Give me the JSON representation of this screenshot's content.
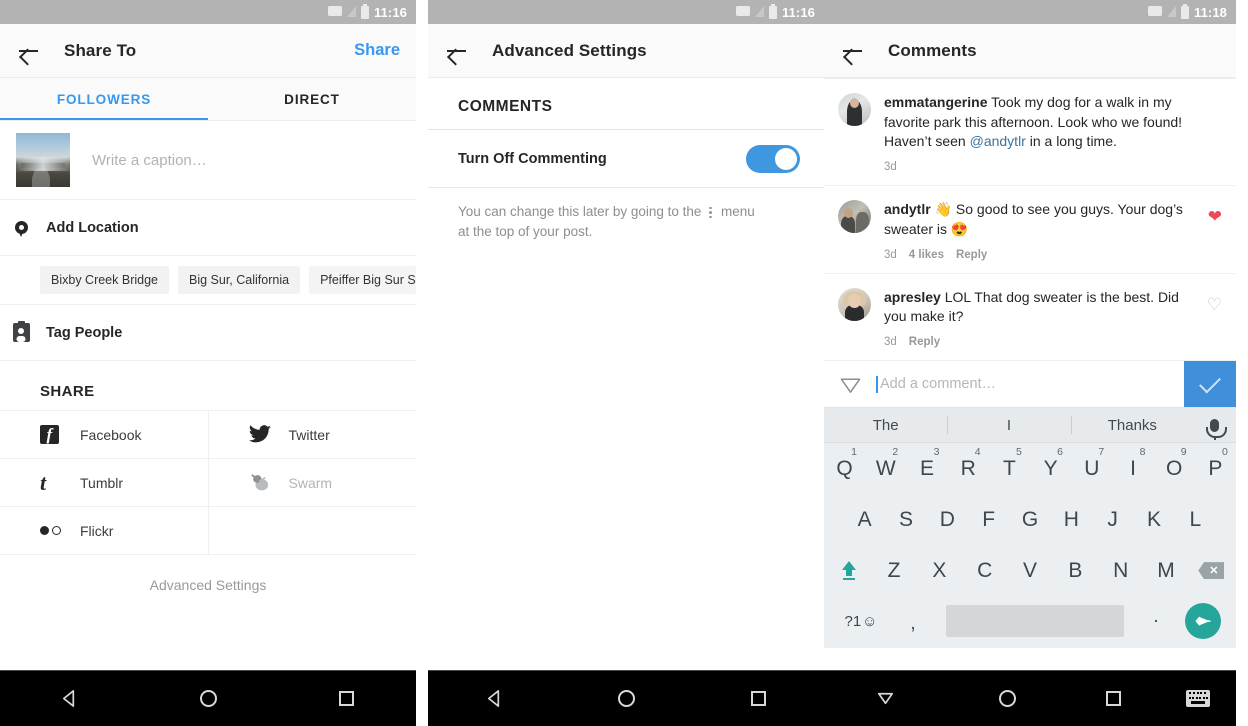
{
  "panel1": {
    "statusbar": {
      "time": "11:16",
      "wifi_icon": "wifi-icon",
      "signal_icon": "signal-icon",
      "battery_icon": "battery-icon"
    },
    "appbar": {
      "back_icon": "back-arrow-icon",
      "title": "Share To",
      "action_label": "Share",
      "action_color": "#3897f0"
    },
    "tabs": [
      {
        "label": "FOLLOWERS",
        "active": true
      },
      {
        "label": "DIRECT",
        "active": false
      }
    ],
    "caption": {
      "placeholder": "Write a caption…",
      "thumbnail_name": "post-thumbnail"
    },
    "location": {
      "icon": "location-pin-icon",
      "label": "Add Location"
    },
    "location_chips": [
      "Bixby Creek Bridge",
      "Big Sur, California",
      "Pfeiffer Big Sur State Park"
    ],
    "tag_people": {
      "icon": "tag-badge-icon",
      "label": "Tag People"
    },
    "share_section_title": "SHARE",
    "share_targets": [
      {
        "label": "Facebook",
        "icon": "facebook-icon",
        "disabled": false
      },
      {
        "label": "Twitter",
        "icon": "twitter-icon",
        "disabled": false
      },
      {
        "label": "Tumblr",
        "icon": "tumblr-icon",
        "disabled": false
      },
      {
        "label": "Swarm",
        "icon": "swarm-icon",
        "disabled": true
      },
      {
        "label": "Flickr",
        "icon": "flickr-icon",
        "disabled": false
      }
    ],
    "advanced_settings_link": "Advanced Settings",
    "navbar": {
      "back": "nav-back-icon",
      "home": "nav-home-icon",
      "recents": "nav-recents-icon"
    }
  },
  "panel2": {
    "statusbar": {
      "time": "11:16"
    },
    "appbar": {
      "back_icon": "back-arrow-icon",
      "title": "Advanced Settings"
    },
    "section_title": "COMMENTS",
    "toggle": {
      "label": "Turn Off Commenting",
      "state": "on",
      "track_color": "#3f97e0"
    },
    "helper_text_before": "You can change this later by going to the",
    "helper_menu_icon": "overflow-menu-icon",
    "helper_text_after": "menu at the top of your post.",
    "navbar": {
      "back": "nav-back-icon",
      "home": "nav-home-icon",
      "recents": "nav-recents-icon"
    }
  },
  "panel3": {
    "statusbar": {
      "time": "11:18"
    },
    "appbar": {
      "back_icon": "back-arrow-icon",
      "title": "Comments"
    },
    "comments": [
      {
        "username": "emmatangerine",
        "text_1": " Took my dog for a walk in my favorite park this afternoon. Look who we found! Haven’t seen ",
        "mention": "@andytlr",
        "text_2": " in a long time.",
        "time": "3d",
        "likes": "",
        "reply": "",
        "liked": false,
        "show_heart": false,
        "avatar": "avatar-emmatangerine"
      },
      {
        "username": "andytlr",
        "text_1": " 👋 So good to see you guys. Your dog’s sweater is 😍",
        "mention": "",
        "text_2": "",
        "time": "3d",
        "likes": "4 likes",
        "reply": "Reply",
        "liked": true,
        "show_heart": true,
        "avatar": "avatar-andytlr"
      },
      {
        "username": "apresley",
        "text_1": " LOL That dog sweater is the best. Did you make it?",
        "mention": "",
        "text_2": "",
        "time": "3d",
        "likes": "",
        "reply": "Reply",
        "liked": false,
        "show_heart": true,
        "avatar": "avatar-apresley"
      }
    ],
    "comment_input": {
      "placeholder": "Add a comment…",
      "leading_icon": "paper-plane-icon",
      "submit_icon": "check-icon",
      "submit_color": "#3f8fdb"
    },
    "keyboard": {
      "suggestions": [
        "The",
        "I",
        "Thanks"
      ],
      "mic_icon": "microphone-icon",
      "row1": [
        {
          "key": "Q",
          "num": "1"
        },
        {
          "key": "W",
          "num": "2"
        },
        {
          "key": "E",
          "num": "3"
        },
        {
          "key": "R",
          "num": "4"
        },
        {
          "key": "T",
          "num": "5"
        },
        {
          "key": "Y",
          "num": "6"
        },
        {
          "key": "U",
          "num": "7"
        },
        {
          "key": "I",
          "num": "8"
        },
        {
          "key": "O",
          "num": "9"
        },
        {
          "key": "P",
          "num": "0"
        }
      ],
      "row2": [
        "A",
        "S",
        "D",
        "F",
        "G",
        "H",
        "J",
        "K",
        "L"
      ],
      "row3": [
        "Z",
        "X",
        "C",
        "V",
        "B",
        "N",
        "M"
      ],
      "shift_icon": "shift-key-icon",
      "delete_icon": "backspace-key-icon",
      "symbols_label": "?1",
      "symbols_emoji": "☺",
      "comma": ",",
      "period": ".",
      "send_icon": "send-key-icon",
      "accent_color": "#26a69a"
    },
    "navbar": {
      "back": "nav-dismiss-keyboard-icon",
      "home": "nav-home-icon",
      "recents": "nav-recents-icon",
      "keyboard": "nav-keyboard-icon"
    }
  }
}
